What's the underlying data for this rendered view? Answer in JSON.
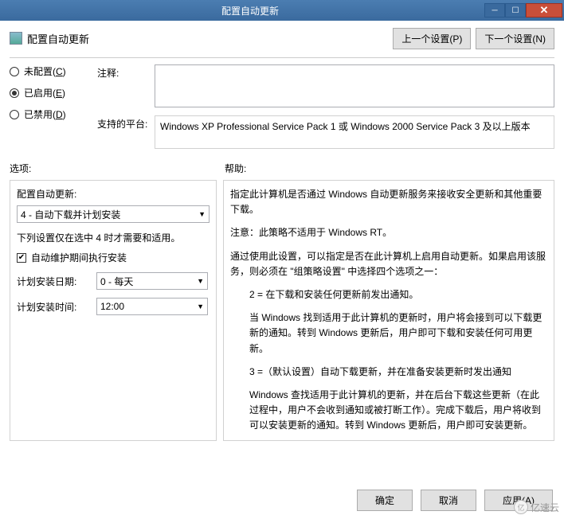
{
  "title": "配置自动更新",
  "header": {
    "title": "配置自动更新",
    "prev": "上一个设置(P)",
    "next": "下一个设置(N)"
  },
  "radios": {
    "unconfigured": {
      "label": "未配置(",
      "key": "C",
      "suffix": ")"
    },
    "enabled": {
      "label": "已启用(",
      "key": "E",
      "suffix": ")"
    },
    "disabled": {
      "label": "已禁用(",
      "key": "D",
      "suffix": ")"
    }
  },
  "fields": {
    "comment_label": "注释:",
    "platform_label": "支持的平台:",
    "platform_text": "Windows XP Professional Service Pack 1 或 Windows 2000 Service Pack 3 及以上版本"
  },
  "sections": {
    "options": "选项:",
    "help": "帮助:"
  },
  "options": {
    "config_label": "配置自动更新:",
    "config_value": "4 - 自动下载并计划安装",
    "note": "下列设置仅在选中 4 时才需要和适用。",
    "checkbox": "自动维护期间执行安装",
    "day_label": "计划安装日期:",
    "day_value": "0 - 每天",
    "time_label": "计划安装时间:",
    "time_value": "12:00"
  },
  "help": {
    "p1": "指定此计算机是否通过 Windows 自动更新服务来接收安全更新和其他重要下载。",
    "p2": "注意：此策略不适用于 Windows RT。",
    "p3": "通过使用此设置，可以指定是否在此计算机上启用自动更新。如果启用该服务，则必须在 \"组策略设置\" 中选择四个选项之一：",
    "p4": "2 = 在下载和安装任何更新前发出通知。",
    "p5": "当 Windows 找到适用于此计算机的更新时，用户将会接到可以下载更新的通知。转到 Windows 更新后，用户即可下载和安装任何可用更新。",
    "p6": "3 =（默认设置）自动下载更新，并在准备安装更新时发出通知",
    "p7": "Windows 查找适用于此计算机的更新，并在后台下载这些更新（在此过程中，用户不会收到通知或被打断工作）。完成下载后，用户将收到可以安装更新的通知。转到 Windows 更新后，用户即可安装更新。"
  },
  "footer": {
    "ok": "确定",
    "cancel": "取消",
    "apply": "应用(A)"
  },
  "watermark": "亿速云"
}
